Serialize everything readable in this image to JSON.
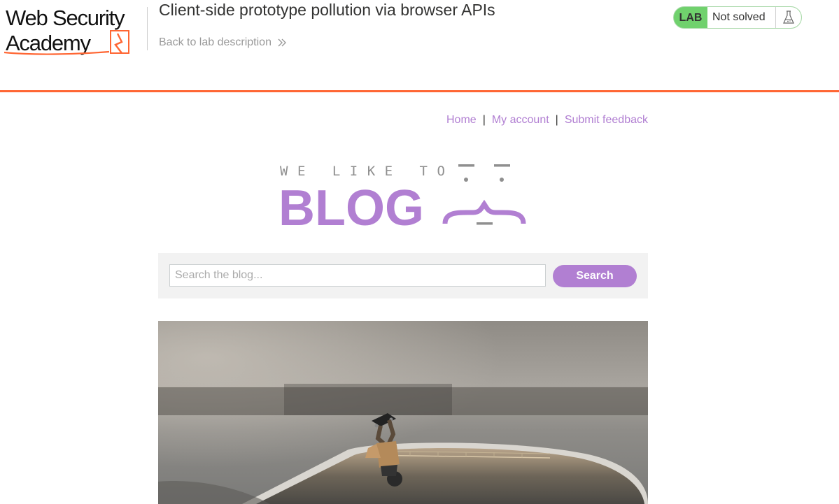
{
  "academy": {
    "logo_text": "Web Security Academy",
    "lab_title": "Client-side prototype pollution via browser APIs",
    "back_link": "Back to lab description",
    "lab_badge": "LAB",
    "lab_status": "Not solved",
    "status_icon": "flask-icon",
    "accent_color": "#ff6633",
    "status_color": "#70d16d"
  },
  "nav": {
    "items": [
      {
        "label": "Home"
      },
      {
        "label": "My account"
      },
      {
        "label": "Submit feedback"
      }
    ],
    "separator": "|",
    "link_color": "#b17fd2"
  },
  "banner": {
    "top_text": "WE LIKE TO",
    "main_text": "BLOG",
    "color": "#b17fd2"
  },
  "search": {
    "placeholder": "Search the blog...",
    "value": "",
    "button_label": "Search"
  },
  "post": {
    "image": "skateboarder-on-phone-photo"
  }
}
